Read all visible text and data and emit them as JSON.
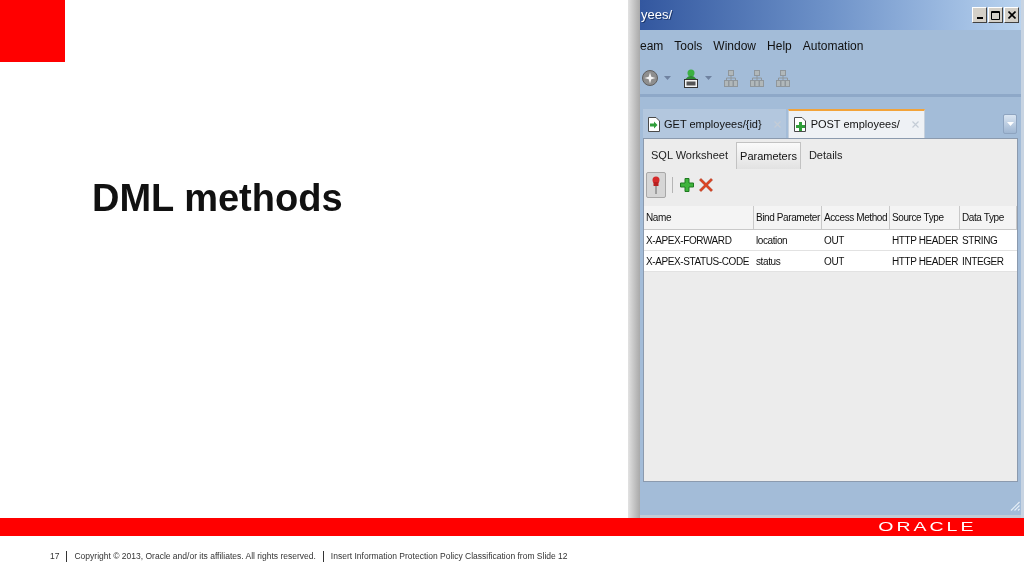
{
  "slide": {
    "title": "DML methods"
  },
  "window": {
    "title": "yees/",
    "menu": [
      "eam",
      "Tools",
      "Window",
      "Help",
      "Automation"
    ],
    "toolbar": [
      {
        "kind": "disc",
        "dropdown": true,
        "disabled": false
      },
      {
        "kind": "sql-user",
        "dropdown": true,
        "disabled": false
      },
      {
        "kind": "hierarchy",
        "dropdown": false,
        "disabled": true
      },
      {
        "kind": "hierarchy",
        "dropdown": false,
        "disabled": true
      },
      {
        "kind": "hierarchy",
        "dropdown": false,
        "disabled": true
      }
    ],
    "editor_tabs": [
      {
        "kind": "get",
        "label": "GET employees/{id}",
        "selected": false
      },
      {
        "kind": "post",
        "label": "POST employees/",
        "selected": true
      }
    ],
    "subtabs": [
      {
        "label": "SQL Worksheet",
        "selected": false
      },
      {
        "label": "Parameters",
        "selected": true
      },
      {
        "label": "Details",
        "selected": false
      }
    ],
    "panel_toolbar": [
      {
        "kind": "pin",
        "pressed": true
      },
      {
        "kind": "add",
        "pressed": false
      },
      {
        "kind": "delete",
        "pressed": false
      }
    ],
    "table": {
      "columns": [
        "Name",
        "Bind Parameter",
        "Access Method",
        "Source Type",
        "Data Type"
      ],
      "rows": [
        [
          "X-APEX-FORWARD",
          "location",
          "OUT",
          "HTTP HEADER",
          "STRING"
        ],
        [
          "X-APEX-STATUS-CODE",
          "status",
          "OUT",
          "HTTP HEADER",
          "INTEGER"
        ]
      ]
    }
  },
  "footer": {
    "logo": "ORACLE",
    "page_number": "17",
    "copyright": "Copyright © 2013, Oracle and/or its affiliates. All rights reserved.",
    "classification": "Insert Information Protection Policy Classification from Slide 12"
  }
}
